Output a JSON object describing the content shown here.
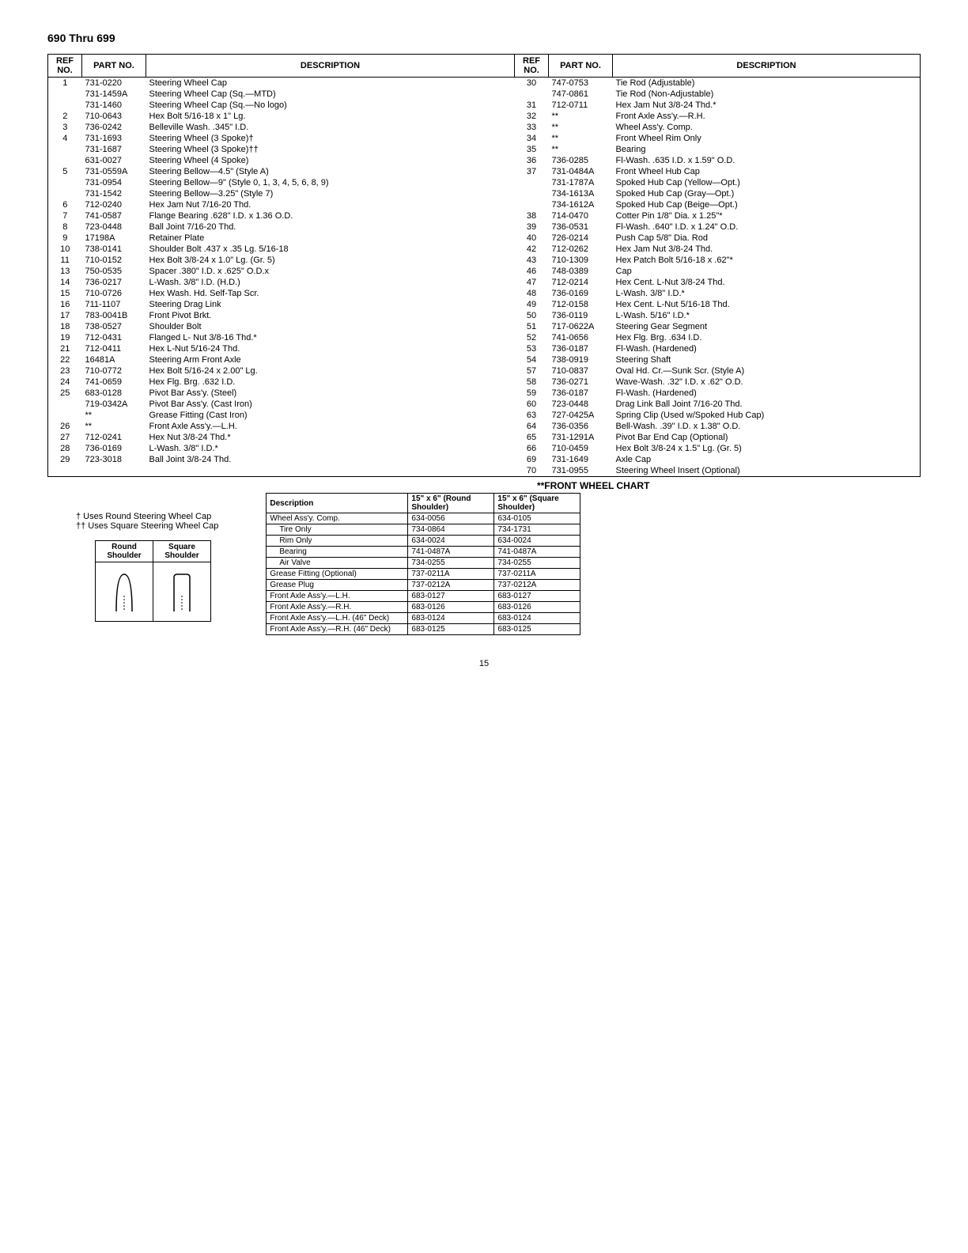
{
  "page_title": "690 Thru 699",
  "headers": {
    "ref": "REF NO.",
    "part": "PART NO.",
    "desc": "DESCRIPTION"
  },
  "left_rows": [
    {
      "ref": "1",
      "part": "731-0220",
      "desc": "Steering Wheel Cap"
    },
    {
      "ref": "",
      "part": "731-1459A",
      "desc": "Steering Wheel Cap (Sq.—MTD)"
    },
    {
      "ref": "",
      "part": "731-1460",
      "desc": "Steering Wheel Cap (Sq.—No logo)"
    },
    {
      "ref": "2",
      "part": "710-0643",
      "desc": "Hex Bolt 5/16-18 x 1\" Lg."
    },
    {
      "ref": "3",
      "part": "736-0242",
      "desc": "Belleville Wash. .345\" I.D."
    },
    {
      "ref": "4",
      "part": "731-1693",
      "desc": "Steering Wheel (3 Spoke)†"
    },
    {
      "ref": "",
      "part": "731-1687",
      "desc": "Steering Wheel (3 Spoke)††"
    },
    {
      "ref": "",
      "part": "631-0027",
      "desc": "Steering Wheel (4 Spoke)"
    },
    {
      "ref": "5",
      "part": "731-0559A",
      "desc": "Steering Bellow—4.5\" (Style A)"
    },
    {
      "ref": "",
      "part": "731-0954",
      "desc": "Steering Bellow—9\" (Style 0, 1, 3, 4, 5, 6, 8, 9)"
    },
    {
      "ref": "",
      "part": "731-1542",
      "desc": "Steering Bellow—3.25\" (Style 7)"
    },
    {
      "ref": "6",
      "part": "712-0240",
      "desc": "Hex Jam Nut 7/16-20 Thd."
    },
    {
      "ref": "7",
      "part": "741-0587",
      "desc": "Flange Bearing .628\" I.D. x 1.36 O.D."
    },
    {
      "ref": "8",
      "part": "723-0448",
      "desc": "Ball Joint 7/16-20 Thd."
    },
    {
      "ref": "9",
      "part": "17198A",
      "desc": "Retainer Plate"
    },
    {
      "ref": "10",
      "part": "738-0141",
      "desc": "Shoulder Bolt .437 x .35 Lg. 5/16-18"
    },
    {
      "ref": "11",
      "part": "710-0152",
      "desc": "Hex Bolt 3/8-24 x 1.0\" Lg. (Gr. 5)"
    },
    {
      "ref": "13",
      "part": "750-0535",
      "desc": "Spacer .380\" I.D. x .625\" O.D.x"
    },
    {
      "ref": "14",
      "part": "736-0217",
      "desc": "L-Wash. 3/8\" I.D. (H.D.)"
    },
    {
      "ref": "15",
      "part": "710-0726",
      "desc": "Hex Wash. Hd. Self-Tap Scr."
    },
    {
      "ref": "16",
      "part": "711-1107",
      "desc": "Steering Drag Link"
    },
    {
      "ref": "17",
      "part": "783-0041B",
      "desc": "Front Pivot Brkt."
    },
    {
      "ref": "18",
      "part": "738-0527",
      "desc": "Shoulder Bolt"
    },
    {
      "ref": "19",
      "part": "712-0431",
      "desc": "Flanged L- Nut 3/8-16 Thd.*"
    },
    {
      "ref": "21",
      "part": "712-0411",
      "desc": "Hex L-Nut 5/16-24 Thd."
    },
    {
      "ref": "22",
      "part": "16481A",
      "desc": "Steering Arm Front Axle"
    },
    {
      "ref": "23",
      "part": "710-0772",
      "desc": "Hex Bolt 5/16-24 x 2.00\" Lg."
    },
    {
      "ref": "24",
      "part": "741-0659",
      "desc": "Hex Flg. Brg. .632 I.D."
    },
    {
      "ref": "25",
      "part": "683-0128",
      "desc": "Pivot Bar Ass'y. (Steel)"
    },
    {
      "ref": "",
      "part": "719-0342A",
      "desc": "Pivot Bar Ass'y. (Cast Iron)"
    },
    {
      "ref": "",
      "part": "**",
      "desc": "Grease Fitting (Cast Iron)"
    },
    {
      "ref": "26",
      "part": "**",
      "desc": "Front Axle Ass'y.—L.H."
    },
    {
      "ref": "27",
      "part": "712-0241",
      "desc": "Hex Nut 3/8-24 Thd.*"
    },
    {
      "ref": "28",
      "part": "736-0169",
      "desc": "L-Wash. 3/8\" I.D.*"
    },
    {
      "ref": "29",
      "part": "723-3018",
      "desc": "Ball Joint 3/8-24 Thd."
    }
  ],
  "right_rows": [
    {
      "ref": "30",
      "part": "747-0753",
      "desc": "Tie Rod (Adjustable)"
    },
    {
      "ref": "",
      "part": "747-0861",
      "desc": "Tie Rod (Non-Adjustable)"
    },
    {
      "ref": "31",
      "part": "712-0711",
      "desc": "Hex Jam Nut 3/8-24 Thd.*"
    },
    {
      "ref": "32",
      "part": "**",
      "desc": "Front Axle Ass'y.—R.H."
    },
    {
      "ref": "33",
      "part": "**",
      "desc": "Wheel Ass'y. Comp."
    },
    {
      "ref": "34",
      "part": "**",
      "desc": "Front Wheel Rim Only"
    },
    {
      "ref": "35",
      "part": "**",
      "desc": "Bearing"
    },
    {
      "ref": "36",
      "part": "736-0285",
      "desc": "Fl-Wash. .635 I.D. x 1.59\" O.D."
    },
    {
      "ref": "37",
      "part": "731-0484A",
      "desc": "Front Wheel Hub Cap"
    },
    {
      "ref": "",
      "part": "731-1787A",
      "desc": "Spoked Hub Cap (Yellow—Opt.)"
    },
    {
      "ref": "",
      "part": "734-1613A",
      "desc": "Spoked Hub Cap (Gray—Opt.)"
    },
    {
      "ref": "",
      "part": "734-1612A",
      "desc": "Spoked Hub Cap (Beige—Opt.)"
    },
    {
      "ref": "38",
      "part": "714-0470",
      "desc": "Cotter Pin 1/8\" Dia. x 1.25\"*"
    },
    {
      "ref": "39",
      "part": "736-0531",
      "desc": "Fl-Wash. .640\" I.D. x 1.24\" O.D."
    },
    {
      "ref": "40",
      "part": "726-0214",
      "desc": "Push Cap 5/8\" Dia. Rod"
    },
    {
      "ref": "42",
      "part": "712-0262",
      "desc": "Hex Jam Nut 3/8-24 Thd."
    },
    {
      "ref": "43",
      "part": "710-1309",
      "desc": "Hex Patch Bolt 5/16-18 x .62\"*"
    },
    {
      "ref": "46",
      "part": "748-0389",
      "desc": "Cap"
    },
    {
      "ref": "47",
      "part": "712-0214",
      "desc": "Hex Cent. L-Nut 3/8-24 Thd."
    },
    {
      "ref": "48",
      "part": "736-0169",
      "desc": "L-Wash. 3/8\" I.D.*"
    },
    {
      "ref": "49",
      "part": "712-0158",
      "desc": "Hex Cent. L-Nut 5/16-18 Thd."
    },
    {
      "ref": "50",
      "part": "736-0119",
      "desc": "L-Wash. 5/16\" I.D.*"
    },
    {
      "ref": "51",
      "part": "717-0622A",
      "desc": "Steering Gear Segment"
    },
    {
      "ref": "52",
      "part": "741-0656",
      "desc": "Hex Flg. Brg. .634 I.D."
    },
    {
      "ref": "53",
      "part": "736-0187",
      "desc": "Fl-Wash. (Hardened)"
    },
    {
      "ref": "54",
      "part": "738-0919",
      "desc": "Steering Shaft"
    },
    {
      "ref": "57",
      "part": "710-0837",
      "desc": "Oval Hd. Cr.—Sunk Scr. (Style A)"
    },
    {
      "ref": "58",
      "part": "736-0271",
      "desc": "Wave-Wash. .32\" I.D. x .62\" O.D."
    },
    {
      "ref": "59",
      "part": "736-0187",
      "desc": "Fl-Wash. (Hardened)"
    },
    {
      "ref": "60",
      "part": "723-0448",
      "desc": "Drag Link Ball Joint 7/16-20 Thd."
    },
    {
      "ref": "63",
      "part": "727-0425A",
      "desc": "Spring Clip (Used w/Spoked Hub Cap)"
    },
    {
      "ref": "64",
      "part": "736-0356",
      "desc": "Bell-Wash. .39\" I.D. x 1.38\" O.D."
    },
    {
      "ref": "65",
      "part": "731-1291A",
      "desc": "Pivot Bar End Cap (Optional)"
    },
    {
      "ref": "66",
      "part": "710-0459",
      "desc": "Hex Bolt 3/8-24 x 1.5\" Lg. (Gr. 5)"
    },
    {
      "ref": "69",
      "part": "731-1649",
      "desc": "Axle Cap"
    },
    {
      "ref": "70",
      "part": "731-0955",
      "desc": "Steering Wheel Insert (Optional)"
    }
  ],
  "footnotes": {
    "single": "† Uses Round Steering Wheel Cap",
    "double": "†† Uses Square Steering Wheel Cap"
  },
  "shoulder": {
    "round": "Round Shoulder",
    "square": "Square Shoulder"
  },
  "wheel_chart": {
    "title": "**FRONT WHEEL CHART",
    "headers": {
      "desc": "Description",
      "col1": "15\" x 6\" (Round Shoulder)",
      "col2": "15\" x 6\" (Square Shoulder)"
    },
    "rows": [
      {
        "desc": "Wheel Ass'y. Comp.",
        "c1": "634-0056",
        "c2": "634-0105",
        "indent": false
      },
      {
        "desc": "Tire Only",
        "c1": "734-0864",
        "c2": "734-1731",
        "indent": true
      },
      {
        "desc": "Rim Only",
        "c1": "634-0024",
        "c2": "634-0024",
        "indent": true
      },
      {
        "desc": "Bearing",
        "c1": "741-0487A",
        "c2": "741-0487A",
        "indent": true
      },
      {
        "desc": "Air Valve",
        "c1": "734-0255",
        "c2": "734-0255",
        "indent": true
      },
      {
        "desc": "Grease Fitting (Optional)",
        "c1": "737-0211A",
        "c2": "737-0211A",
        "indent": false
      },
      {
        "desc": "Grease Plug",
        "c1": "737-0212A",
        "c2": "737-0212A",
        "indent": false
      },
      {
        "desc": "Front Axle Ass'y.—L.H.",
        "c1": "683-0127",
        "c2": "683-0127",
        "indent": false
      },
      {
        "desc": "Front Axle Ass'y.—R.H.",
        "c1": "683-0126",
        "c2": "683-0126",
        "indent": false
      },
      {
        "desc": "Front Axle Ass'y.—L.H. (46\" Deck)",
        "c1": "683-0124",
        "c2": "683-0124",
        "indent": false
      },
      {
        "desc": "Front Axle Ass'y.—R.H. (46\" Deck)",
        "c1": "683-0125",
        "c2": "683-0125",
        "indent": false
      }
    ]
  },
  "page_number": "15"
}
